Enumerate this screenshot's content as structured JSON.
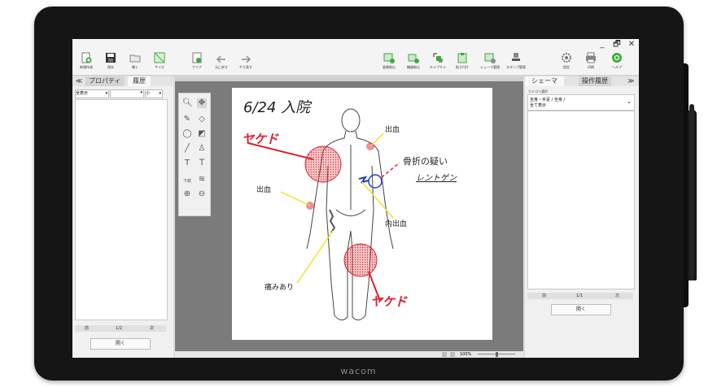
{
  "window": {
    "minimize": "_",
    "restore": "🗗",
    "close": "✕"
  },
  "toolbar": {
    "left": [
      {
        "label": "新規作成",
        "icon": "new-document-icon"
      },
      {
        "label": "保存",
        "icon": "save-icon"
      },
      {
        "label": "開く",
        "icon": "open-folder-icon"
      },
      {
        "label": "サイズ",
        "icon": "resize-icon"
      },
      {
        "label": "クリア",
        "icon": "clear-icon"
      },
      {
        "label": "元に戻す",
        "icon": "undo-icon"
      },
      {
        "label": "やり直す",
        "icon": "redo-icon"
      }
    ],
    "right": [
      {
        "label": "画像取込",
        "icon": "image-import-icon"
      },
      {
        "label": "機器取込",
        "icon": "device-import-icon"
      },
      {
        "label": "キャプチャ",
        "icon": "capture-icon"
      },
      {
        "label": "貼り付け",
        "icon": "paste-icon"
      },
      {
        "label": "シェーマ管理",
        "icon": "schema-manage-icon"
      },
      {
        "label": "スタンプ管理",
        "icon": "stamp-manage-icon"
      },
      {
        "label": "設定",
        "icon": "settings-icon"
      },
      {
        "label": "印刷",
        "icon": "print-icon"
      },
      {
        "label": "ヘルプ",
        "icon": "help-icon"
      }
    ]
  },
  "left_panel": {
    "collapse": "≪",
    "tab_properties": "プロパティ",
    "tab_history": "履歴",
    "filter_value": "全表示",
    "size_value": "小",
    "pager": {
      "prev": "前",
      "page": "1/2",
      "next": "次"
    },
    "open_button": "開く"
  },
  "right_panel": {
    "tab_schema": "シェーマ",
    "tab_operation_history": "操作履歴",
    "expand": "≫",
    "category_label": "カテゴリ選択",
    "category_value_line1": "全身・手足 / 全身 /",
    "category_value_line2": "全て表示",
    "pager": {
      "prev": "前",
      "page": "1/1",
      "next": "次"
    },
    "open_button": "開く"
  },
  "toolbox": {
    "underlay_label": "下絵"
  },
  "status": {
    "zoom": "100%"
  },
  "canvas": {
    "heading": "6/24 入院",
    "notes": [
      {
        "text": "出血",
        "color": "#222222"
      },
      {
        "text": "骨折の疑い",
        "color": "#222222"
      },
      {
        "text": "レントゲン",
        "color": "#222222"
      },
      {
        "text": "出血",
        "color": "#222222"
      },
      {
        "text": "内出血",
        "color": "#222222"
      },
      {
        "text": "痛みあり",
        "color": "#222222"
      },
      {
        "text": "ヤケド",
        "color": "#e01e2e"
      },
      {
        "text": "ヤケド",
        "color": "#e01e2e"
      }
    ]
  },
  "brand": "wacom",
  "colors": {
    "red": "#e01e2e",
    "blue": "#1f3fbf",
    "yellow": "#f5e02a",
    "green": "#3cab3c"
  }
}
